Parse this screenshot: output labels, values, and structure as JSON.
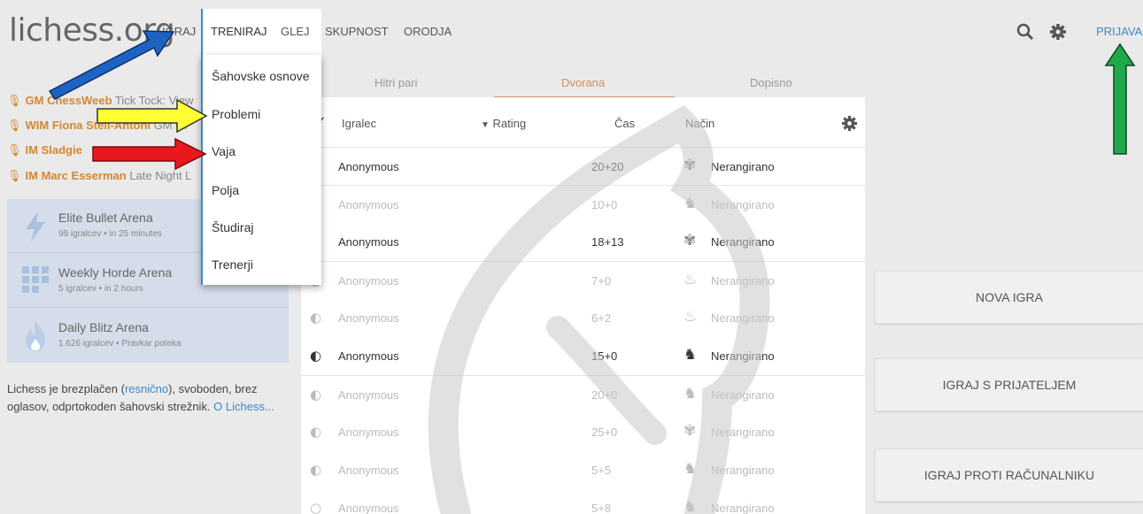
{
  "header": {
    "logo": "lichess.org",
    "nav": [
      "IGRAJ",
      "TRENIRAJ",
      "GLEJ",
      "SKUPNOST",
      "ORODJA"
    ],
    "search_icon": "search-icon",
    "settings_icon": "gear-icon",
    "signin": "PRIJAVA"
  },
  "dropdown": {
    "items": [
      "Šahovske osnove",
      "Problemi",
      "Vaja",
      "Polja",
      "Študiraj",
      "Trenerji"
    ]
  },
  "streamers": [
    {
      "name": "GM ChessWeeb",
      "rest": "Tick Tock: View"
    },
    {
      "name": "WIM Fiona Steil-Antoni",
      "rest": "GM Ol"
    },
    {
      "name": "IM Sladgie",
      "rest": ""
    },
    {
      "name": "IM Marc Esserman",
      "rest": "Late Night L"
    }
  ],
  "tournaments": [
    {
      "name": "Elite Bullet Arena",
      "players": "99 igralcev",
      "when": "in 25 minutes",
      "icon": "bullet-icon"
    },
    {
      "name": "Weekly Horde Arena",
      "players": "5 igralcev",
      "when": "in 2 hours",
      "icon": "horde-icon"
    },
    {
      "name": "Daily Blitz Arena",
      "players": "1.626 igralcev",
      "when": "Pravkar poteka",
      "icon": "blitz-flame-icon"
    }
  ],
  "about": {
    "text1": "Lichess je brezplačen (",
    "link1": "resnično",
    "text2": "), svoboden, brez oglasov, odprtokoden šahovski strežnik. ",
    "link2": "O Lichess..."
  },
  "tabs": [
    "Hitri pari",
    "Dvorana",
    "Dopisno"
  ],
  "active_tab": "Dvorana",
  "table": {
    "headers": {
      "player": "Igralec",
      "rating": "Rating",
      "time": "Čas",
      "mode": "Način"
    },
    "rows": [
      {
        "player": "Anonymous",
        "time": "20+20",
        "mode": "Nerangirano",
        "dim": false
      },
      {
        "player": "Anonymous",
        "time": "10+0",
        "mode": "Nerangirano",
        "dim": true
      },
      {
        "player": "Anonymous",
        "time": "18+13",
        "mode": "Nerangirano",
        "dim": false
      },
      {
        "player": "Anonymous",
        "time": "7+0",
        "mode": "Nerangirano",
        "dim": true
      },
      {
        "player": "Anonymous",
        "time": "6+2",
        "mode": "Nerangirano",
        "dim": true
      },
      {
        "player": "Anonymous",
        "time": "15+0",
        "mode": "Nerangirano",
        "dim": false
      },
      {
        "player": "Anonymous",
        "time": "20+0",
        "mode": "Nerangirano",
        "dim": true
      },
      {
        "player": "Anonymous",
        "time": "25+0",
        "mode": "Nerangirano",
        "dim": true
      },
      {
        "player": "Anonymous",
        "time": "5+5",
        "mode": "Nerangirano",
        "dim": true
      },
      {
        "player": "Anonymous",
        "time": "5+8",
        "mode": "Nerangirano",
        "dim": true
      }
    ]
  },
  "buttons": {
    "new_game": "NOVA IGRA",
    "play_friend": "IGRAJ S PRIJATELJEM",
    "play_computer": "IGRAJ PROTI RAČUNALNIKU"
  },
  "colors": {
    "accent": "#3b87c8",
    "streamer": "#d4872e",
    "tab_underline": "#d18f5e",
    "arrow_blue": "#1e63c4",
    "arrow_yellow": "#ffff33",
    "arrow_red": "#e8181d",
    "arrow_green": "#21a84a"
  }
}
